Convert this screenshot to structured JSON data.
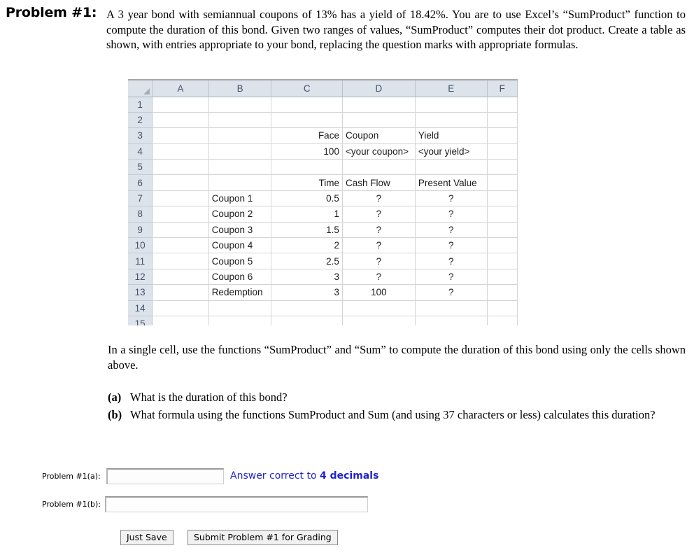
{
  "problem": {
    "label": "Problem #1:",
    "statement": "A 3 year bond with semiannual coupons of 13% has a yield of 18.42%. You are to use Excel’s “SumProduct” function to compute the duration of this bond. Given two ranges of values, “SumProduct” computes their dot product. Create a table as shown, with entries appropriate to your bond, replacing the question marks with appropriate formulas.",
    "mid_text": "In a single cell, use the functions “SumProduct” and “Sum” to compute the duration of this bond using only the cells shown above.",
    "parts": [
      {
        "marker": "(a)",
        "text": "What is the duration of this bond?"
      },
      {
        "marker": "(b)",
        "text": "What formula using the functions SumProduct and Sum (and using 37 characters or less) calculates this duration?"
      }
    ]
  },
  "spreadsheet": {
    "corner_icon": "select-all-triangle-icon",
    "column_headers": [
      "A",
      "B",
      "C",
      "D",
      "E",
      "F"
    ],
    "row_headers": [
      "1",
      "2",
      "3",
      "4",
      "5",
      "6",
      "7",
      "8",
      "9",
      "10",
      "11",
      "12",
      "13",
      "14",
      "15"
    ],
    "rows": [
      {
        "n": "1",
        "A": "",
        "B": "",
        "C": "",
        "D": "",
        "E": "",
        "F": ""
      },
      {
        "n": "2",
        "A": "",
        "B": "",
        "C": "",
        "D": "",
        "E": "",
        "F": ""
      },
      {
        "n": "3",
        "A": "",
        "B": "",
        "C": "Face",
        "D": "Coupon",
        "E": "Yield",
        "F": ""
      },
      {
        "n": "4",
        "A": "",
        "B": "",
        "C": "100",
        "D": "<your coupon>",
        "E": "<your yield>",
        "F": ""
      },
      {
        "n": "5",
        "A": "",
        "B": "",
        "C": "",
        "D": "",
        "E": "",
        "F": ""
      },
      {
        "n": "6",
        "A": "",
        "B": "",
        "C": "Time",
        "D": "Cash Flow",
        "E": "Present Value",
        "F": ""
      },
      {
        "n": "7",
        "A": "",
        "B": "Coupon 1",
        "C": "0.5",
        "D": "?",
        "E": "?",
        "F": ""
      },
      {
        "n": "8",
        "A": "",
        "B": "Coupon 2",
        "C": "1",
        "D": "?",
        "E": "?",
        "F": ""
      },
      {
        "n": "9",
        "A": "",
        "B": "Coupon 3",
        "C": "1.5",
        "D": "?",
        "E": "?",
        "F": ""
      },
      {
        "n": "10",
        "A": "",
        "B": "Coupon 4",
        "C": "2",
        "D": "?",
        "E": "?",
        "F": ""
      },
      {
        "n": "11",
        "A": "",
        "B": "Coupon 5",
        "C": "2.5",
        "D": "?",
        "E": "?",
        "F": ""
      },
      {
        "n": "12",
        "A": "",
        "B": "Coupon 6",
        "C": "3",
        "D": "?",
        "E": "?",
        "F": ""
      },
      {
        "n": "13",
        "A": "",
        "B": "Redemption",
        "C": "3",
        "D": "100",
        "E": "?",
        "F": ""
      },
      {
        "n": "14",
        "A": "",
        "B": "",
        "C": "",
        "D": "",
        "E": "",
        "F": ""
      },
      {
        "n": "15",
        "A": "",
        "B": "",
        "C": "",
        "D": "",
        "E": "",
        "F": ""
      }
    ]
  },
  "answers": {
    "label_a": "Problem #1(a):",
    "label_b": "Problem #1(b):",
    "value_a": "",
    "value_b": "",
    "placeholder_a": "",
    "placeholder_b": "",
    "note_prefix": "Answer correct to ",
    "note_emphasis": "4 decimals",
    "note_color": "#2222cc"
  },
  "buttons": {
    "just_save": "Just Save",
    "submit": "Submit Problem #1 for Grading"
  }
}
